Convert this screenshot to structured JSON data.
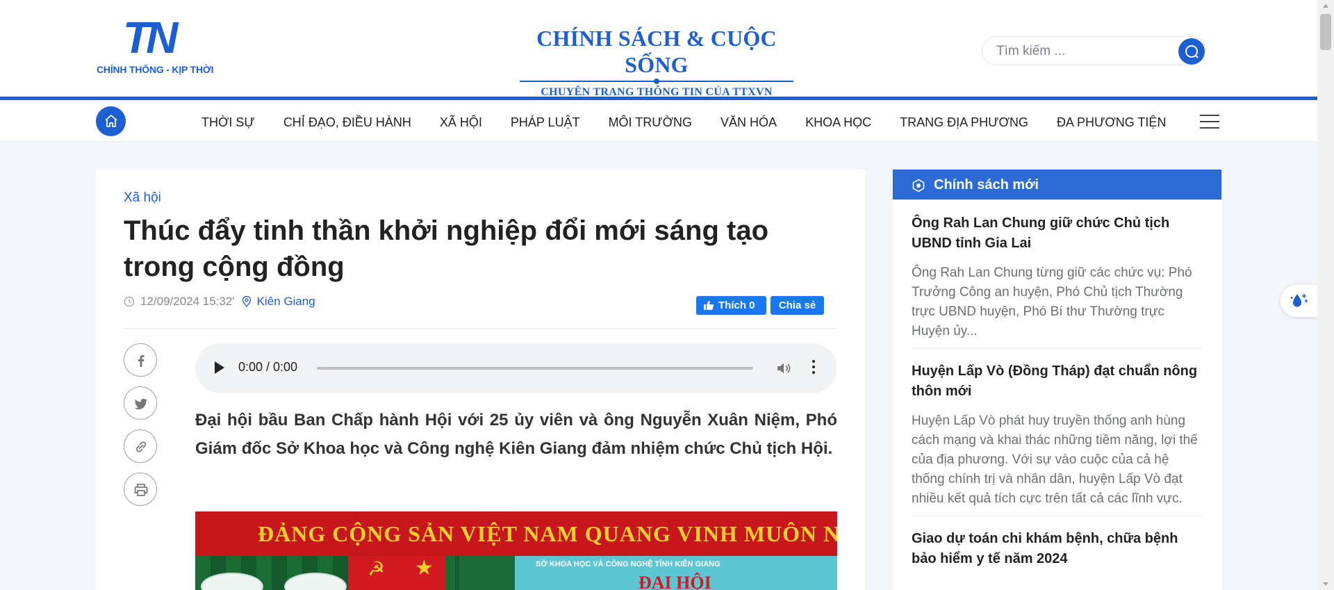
{
  "header": {
    "logo_mark": "TN",
    "logo_tagline": "CHÍNH THỐNG - KỊP THỜI",
    "brand_title": "CHÍNH SÁCH & CUỘC SỐNG",
    "brand_subtitle": "CHUYÊN TRANG THÔNG TIN CỦA TTXVN",
    "search_placeholder": "Tìm kiếm ...",
    "accent_color": "#1c5fd3"
  },
  "nav": {
    "items": [
      {
        "label": "THỜI SỰ"
      },
      {
        "label": "CHỈ ĐẠO, ĐIỀU HÀNH"
      },
      {
        "label": "XÃ HỘI"
      },
      {
        "label": "PHÁP LUẬT"
      },
      {
        "label": "MÔI TRƯỜNG"
      },
      {
        "label": "VĂN HÓA"
      },
      {
        "label": "KHOA HỌC"
      },
      {
        "label": "TRANG ĐỊA PHƯƠNG"
      },
      {
        "label": "ĐA PHƯƠNG TIỆN"
      }
    ]
  },
  "article": {
    "category": "Xã hội",
    "title": "Thúc đẩy tinh thần khởi nghiệp đổi mới sáng tạo trong cộng đồng",
    "datetime": "12/09/2024 15:32'",
    "location": "Kiên Giang",
    "fb_like_label": "Thích 0",
    "fb_share_label": "Chia sẻ",
    "audio_time": "0:00 / 0:00",
    "audio_progress": 0,
    "lead": "Đại hội bầu Ban Chấp hành Hội với 25 ủy viên và ông Nguyễn Xuân Niệm, Phó Giám đốc Sở Khoa học và Công nghệ Kiên Giang đảm nhiệm chức Chủ tịch Hội.",
    "photo": {
      "banner_text": "ĐẢNG CỘNG SẢN VIỆT NAM QUANG VINH MUÔN NĂM!",
      "board_line1": "SỞ KHOA HỌC VÀ CÔNG NGHỆ TỈNH KIÊN GIANG",
      "board_line2": "ĐẠI HỘI"
    }
  },
  "sidebar": {
    "heading": "Chính sách mới",
    "items": [
      {
        "title": "Ông Rah Lan Chung giữ chức Chủ tịch UBND tỉnh Gia Lai",
        "summary": "Ông Rah Lan Chung từng giữ các chức vụ: Phó Trưởng Công an huyện, Phó Chủ tịch Thường trực UBND huyện, Phó Bí thư Thường trực Huyện ủy..."
      },
      {
        "title": "Huyện Lấp Vò (Đồng Tháp) đạt chuẩn nông thôn mới",
        "summary": "Huyện Lấp Vò phát huy truyền thống anh hùng cách mạng và khai thác những tiềm năng, lợi thế của địa phương. Với sự vào cuộc của cả hệ thống chính trị và nhân dân, huyện Lấp Vò đạt nhiều kết quả tích cực trên tất cả các lĩnh vực."
      },
      {
        "title": "Giao dự toán chi khám bệnh, chữa bệnh bảo hiểm y tế năm 2024",
        "summary": ""
      }
    ]
  }
}
